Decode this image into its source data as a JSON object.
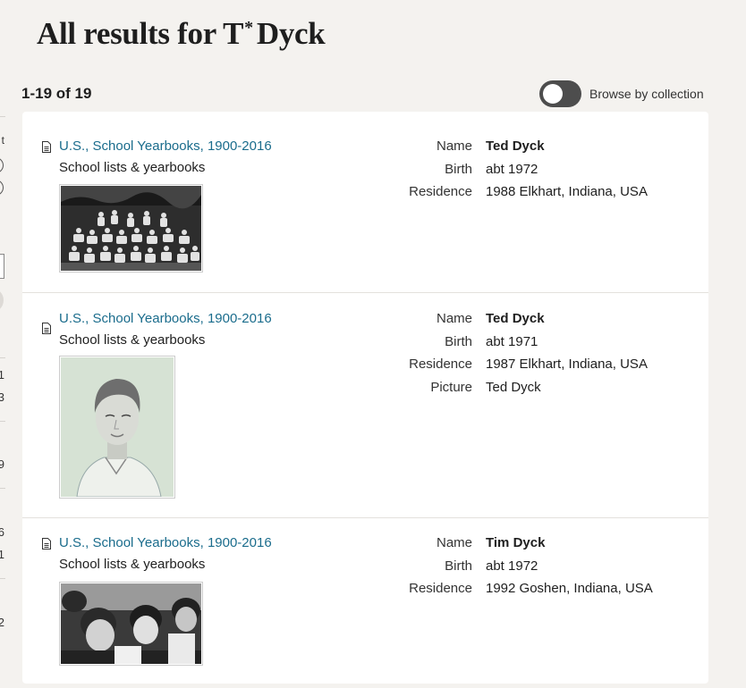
{
  "page": {
    "title_prefix": "All results for T",
    "title_superscript": "*",
    "title_suffix": "Dyck"
  },
  "summary": {
    "count": "1-19 of 19"
  },
  "browse_toggle": {
    "label": "Browse by collection",
    "on": false
  },
  "sidebar_fragments": {
    "text_top": "t",
    "nums": [
      "1",
      "3",
      "9",
      "6",
      "1",
      "2"
    ]
  },
  "results": [
    {
      "collection": "U.S., School Yearbooks, 1900-2016",
      "category": "School lists & yearbooks",
      "photo": "group-photo",
      "fields": [
        {
          "label": "Name",
          "value": "Ted Dyck"
        },
        {
          "label": "Birth",
          "value": "abt 1972"
        },
        {
          "label": "Residence",
          "value": "1988 Elkhart, Indiana, USA"
        }
      ]
    },
    {
      "collection": "U.S., School Yearbooks, 1900-2016",
      "category": "School lists & yearbooks",
      "photo": "portrait-photo",
      "fields": [
        {
          "label": "Name",
          "value": "Ted Dyck"
        },
        {
          "label": "Birth",
          "value": "abt 1971"
        },
        {
          "label": "Residence",
          "value": "1987 Elkhart, Indiana, USA"
        },
        {
          "label": "Picture",
          "value": "Ted Dyck"
        }
      ]
    },
    {
      "collection": "U.S., School Yearbooks, 1900-2016",
      "category": "School lists & yearbooks",
      "photo": "group-photo",
      "fields": [
        {
          "label": "Name",
          "value": "Tim Dyck"
        },
        {
          "label": "Birth",
          "value": "abt 1972"
        },
        {
          "label": "Residence",
          "value": "1992 Goshen, Indiana, USA"
        }
      ]
    }
  ]
}
